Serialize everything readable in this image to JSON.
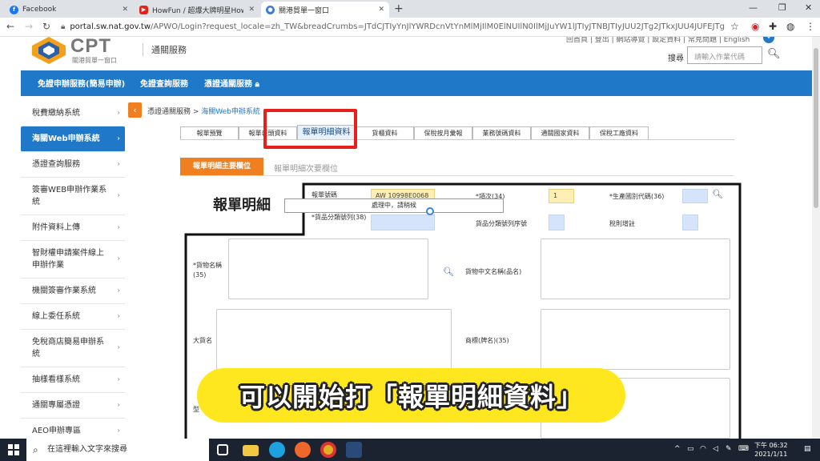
{
  "browser": {
    "tabs": [
      {
        "title": "Facebook",
        "active": false
      },
      {
        "title": "HowFun / 超爆大牌明星How哥",
        "active": false
      },
      {
        "title": "關港貿單一窗口",
        "active": true
      }
    ],
    "new_tab": "+",
    "url_host": "portal.sw.nat.gov.tw",
    "url_path": "/APWO/Login?request_locale=zh_TW&breadCrumbs=JTdCJTIyYnJlYWRDcnVtYnMlMjIlM0ElNUIlN0IlMjJuYW1lJTIyJTNBJTIyJUU2JTg2JTkxJUU4JUFEJTg5JUU5JTgwJ..."
  },
  "header": {
    "logo_text": "CPT",
    "logo_sub": "關港貿單一窗口",
    "service_name": "通關服務",
    "top_links": "回首頁 | 登出 | 網站導覽 | 設定資料 | 常見問題 | English",
    "search_label": "搜尋",
    "search_placeholder": "請輸入作業代碼"
  },
  "main_nav": [
    "免證申辦服務(簡易申辦)",
    "免證查詢服務",
    "憑證通關服務"
  ],
  "sidebar": [
    {
      "label": "稅費繳納系統",
      "active": false
    },
    {
      "label": "海關Web申辦系統",
      "active": true
    },
    {
      "label": "憑證查詢服務",
      "active": false
    },
    {
      "label": "簽審WEB申辦作業系統",
      "active": false
    },
    {
      "label": "附件資料上傳",
      "active": false
    },
    {
      "label": "智財權申請案件線上申辦作業",
      "active": false
    },
    {
      "label": "機關簽審作業系統",
      "active": false
    },
    {
      "label": "線上委任系統",
      "active": false
    },
    {
      "label": "免稅商店簡易申辦系統",
      "active": false
    },
    {
      "label": "抽樣看樣系統",
      "active": false
    },
    {
      "label": "通關專屬憑證",
      "active": false
    },
    {
      "label": "AEO申辦專區",
      "active": false
    }
  ],
  "breadcrumb": {
    "root": "憑證通關服務",
    "sep": " > ",
    "current": "海關Web申辦系統"
  },
  "sub_tabs": [
    "報單預覽",
    "報單表頭資料",
    "報單明細資料",
    "貨櫃資料",
    "保稅按月彙報",
    "業務號碼資料",
    "通關國家資料",
    "保稅工廠資料"
  ],
  "field_tabs": {
    "primary": "報單明細主要欄位",
    "secondary": "報單明細次要欄位"
  },
  "form": {
    "heading": "報單明細",
    "decl_no_label": "報單號碼",
    "decl_no_value": "AW 10998E0068",
    "item_no_label": "*項次(34)",
    "item_no_value": "1",
    "origin_label": "*生產國別代碼(36)",
    "class_no_label": "*貨品分類號列(38)",
    "class_seq_label": "貨品分類號列序號",
    "tax_note_label": "稅則增註",
    "goods_name_label": "*貨物名稱(35)",
    "goods_cn_label": "貨物中文名稱(品名)",
    "big_name_label": "大貨名",
    "brand_label": "商標(牌名)(35)",
    "model_label": "型"
  },
  "loading_text": "處理中，請稍候",
  "caption": "可以開始打「報單明細資料」",
  "taskbar": {
    "search_placeholder": "在這裡輸入文字來搜尋",
    "time": "下午 06:32",
    "date": "2021/1/11"
  }
}
